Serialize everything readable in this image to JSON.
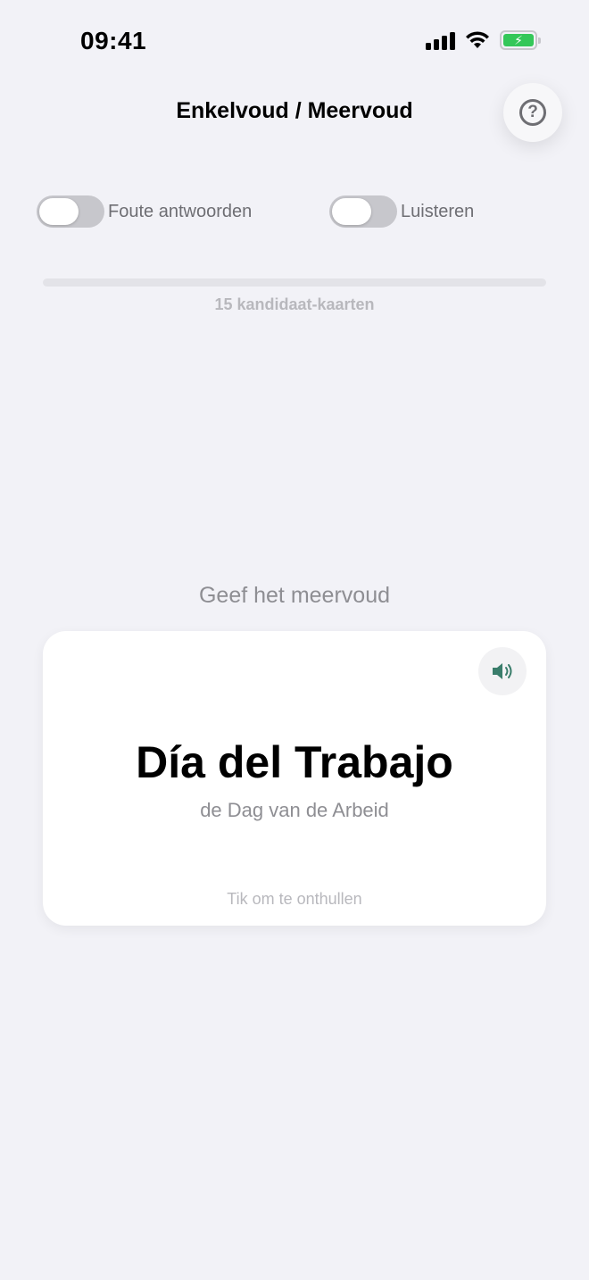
{
  "status_bar": {
    "time": "09:41",
    "icons": [
      "signal-icon",
      "wifi-icon",
      "battery-charging-icon"
    ],
    "battery_color": "#34c759"
  },
  "header": {
    "title": "Enkelvoud / Meervoud",
    "help_icon": "question-circle-icon",
    "help_symbol": "?"
  },
  "toggles": [
    {
      "label": "Foute antwoorden",
      "on": false
    },
    {
      "label": "Luisteren",
      "on": false
    }
  ],
  "progress": {
    "value": 0,
    "label": "15 kandidaat-kaarten"
  },
  "prompt": "Geef het meervoud",
  "card": {
    "word": "Día del Trabajo",
    "translation": "de Dag van de Arbeid",
    "hint": "Tik om te onthullen",
    "speaker_icon": "speaker-icon",
    "speaker_color": "#3a7d6b"
  }
}
